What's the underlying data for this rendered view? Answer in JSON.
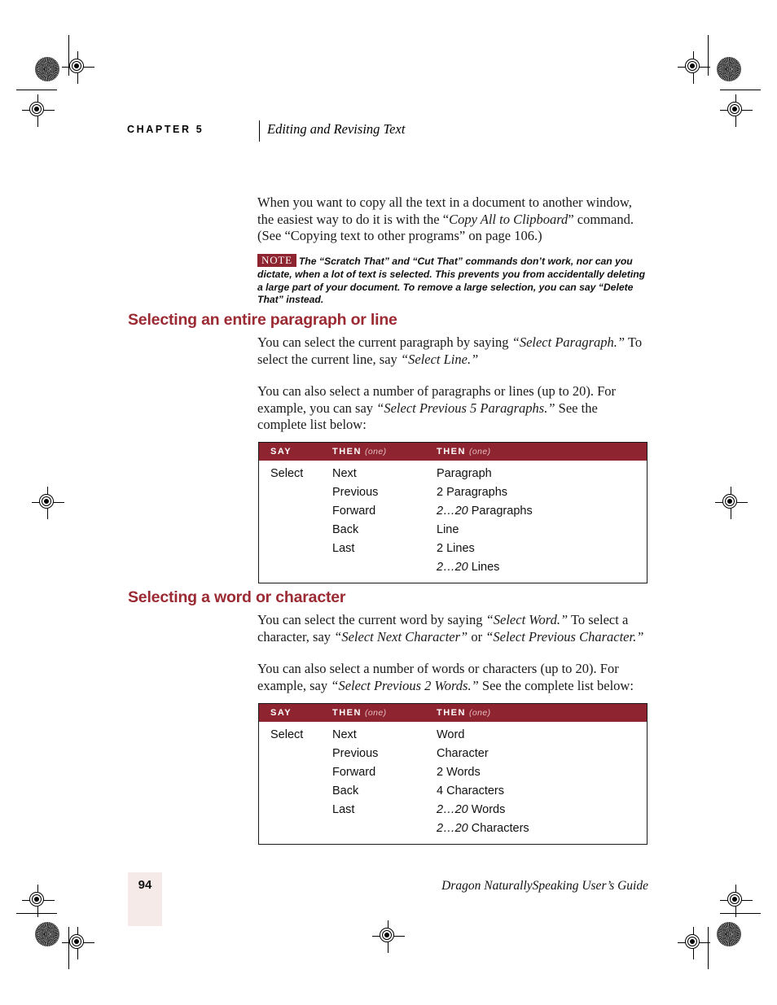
{
  "page": {
    "chapter_label": "CHAPTER 5",
    "chapter_title": "Editing and Revising Text",
    "page_number": "94",
    "footer_title": "Dragon NaturallySpeaking User’s Guide"
  },
  "intro": {
    "paragraph_part1": "When you want to copy all the text in a document to another window, the easiest way to do it is with the “",
    "paragraph_italic": "Copy All to Clipboard",
    "paragraph_part2": "” command. (See “Copying text to other programs” on page 106.)"
  },
  "note": {
    "badge": "NOTE",
    "text": "The “Scratch That” and “Cut That” commands don’t work, nor can you dictate, when a lot of text is selected. This prevents you from accidentally deleting a large part of your document. To remove a large selection, you can say “Delete That” instead."
  },
  "section_paragraph": {
    "heading": "Selecting an entire paragraph or line",
    "p1_a": "You can select the current paragraph by saying ",
    "p1_i1": "“Select Paragraph.”",
    "p1_b": " To select the current line, say ",
    "p1_i2": "“Select Line.”",
    "p2_a": "You can also select a number of paragraphs or lines (up to 20). For example, you can say ",
    "p2_i1": "“Select Previous 5 Paragraphs.”",
    "p2_b": " See the complete list below:"
  },
  "section_word": {
    "heading": "Selecting a word or character",
    "p1_a": "You can select the current word by saying ",
    "p1_i1": "“Select Word.”",
    "p1_b": " To select a character, say ",
    "p1_i2": "“Select Next Character”",
    "p1_c": " or ",
    "p1_i3": "“Select Previous Character.”",
    "p2_a": "You can also select a number of words or characters (up to 20). For example, say ",
    "p2_i1": "“Select Previous 2 Words.”",
    "p2_b": " See the complete list below:"
  },
  "table_paragraph": {
    "headers": {
      "col1": "SAY",
      "col2": "THEN",
      "col2_note": "(one)",
      "col3": "THEN",
      "col3_note": "(one)"
    },
    "rows": [
      {
        "say": "Select",
        "then1": "Next",
        "then2_range": "",
        "then2": "Paragraph"
      },
      {
        "say": "",
        "then1": "Previous",
        "then2_range": "",
        "then2": "2 Paragraphs"
      },
      {
        "say": "",
        "then1": "Forward",
        "then2_range": "2…20 ",
        "then2": "Paragraphs"
      },
      {
        "say": "",
        "then1": "Back",
        "then2_range": "",
        "then2": "Line"
      },
      {
        "say": "",
        "then1": "Last",
        "then2_range": "",
        "then2": "2 Lines"
      },
      {
        "say": "",
        "then1": "",
        "then2_range": "2…20 ",
        "then2": "Lines"
      }
    ]
  },
  "table_word": {
    "headers": {
      "col1": "SAY",
      "col2": "THEN",
      "col2_note": "(one)",
      "col3": "THEN",
      "col3_note": "(one)"
    },
    "rows": [
      {
        "say": "Select",
        "then1": "Next",
        "then2_range": "",
        "then2": "Word"
      },
      {
        "say": "",
        "then1": "Previous",
        "then2_range": "",
        "then2": "Character"
      },
      {
        "say": "",
        "then1": "Forward",
        "then2_range": "",
        "then2": "2 Words"
      },
      {
        "say": "",
        "then1": "Back",
        "then2_range": "",
        "then2": "4 Characters"
      },
      {
        "say": "",
        "then1": "Last",
        "then2_range": "2…20 ",
        "then2": "Words"
      },
      {
        "say": "",
        "then1": "",
        "then2_range": "2…20 ",
        "then2": "Characters"
      }
    ]
  },
  "colors": {
    "accent_red": "#8E2430",
    "heading_red": "#9B2A33",
    "page_number_bg": "#F6EAE9",
    "header_note_text": "#E5BFC2"
  }
}
